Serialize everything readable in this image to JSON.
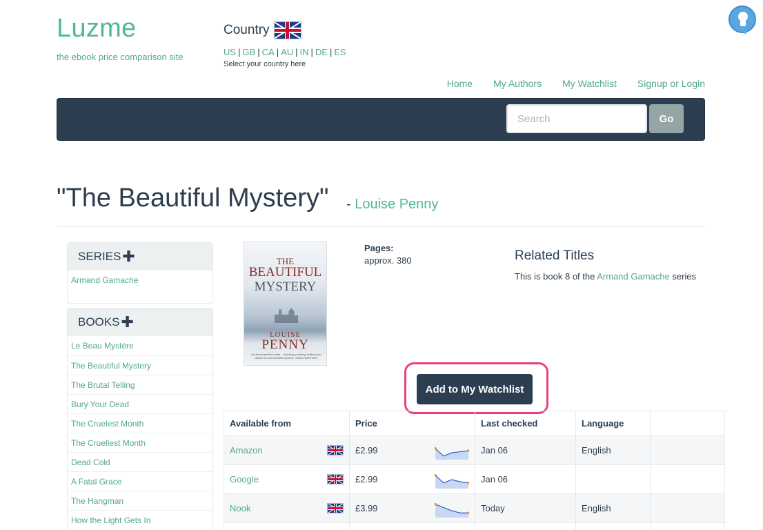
{
  "site": {
    "name": "Luzme",
    "tagline": "the ebook price comparison site"
  },
  "country": {
    "label": "Country",
    "current_flag": "uk-flag-icon",
    "options": [
      "US",
      "GB",
      "CA",
      "AU",
      "IN",
      "DE",
      "ES"
    ],
    "hint": "Select your country here"
  },
  "topnav": {
    "home": "Home",
    "authors": "My Authors",
    "watchlist": "My Watchlist",
    "login": "Signup or Login"
  },
  "search": {
    "placeholder": "Search",
    "button": "Go"
  },
  "book": {
    "title": "\"The Beautiful Mystery\"",
    "author_prefix": "- ",
    "author": "Louise Penny",
    "pages_label": "Pages:",
    "pages_value": "approx. 380",
    "cover": {
      "line1": "THE",
      "line2": "BEAUTIFUL",
      "line3": "MYSTERY",
      "author1": "LOUISE",
      "author2": "PENNY",
      "quote": "'An almost perfect crime – haunting, puzzling, brilliant and indeed a most beautiful mystery' LINDA FAIRSTEIN"
    }
  },
  "related": {
    "heading": "Related Titles",
    "text_before": "This is book 8 of the ",
    "series_link": "Armand Gamache",
    "text_after": " series"
  },
  "series_panel": {
    "heading": "SERIES",
    "items": [
      "Armand Gamache"
    ]
  },
  "books_panel": {
    "heading": "BOOKS",
    "items": [
      "Le Beau Mystère",
      "The Beautiful Mystery",
      "The Brutal Telling",
      "Bury Your Dead",
      "The Cruelest Month",
      "The Cruellest Month",
      "Dead Cold",
      "A Fatal Grace",
      "The Hangman",
      "How the Light Gets In"
    ]
  },
  "watchlist_button": "Add to My Watchlist",
  "prices": {
    "headers": [
      "Available from",
      "Price",
      "Last checked",
      "Language",
      ""
    ],
    "rows": [
      {
        "store": "Amazon",
        "price": "£2.99",
        "checked": "Jan 06",
        "language": "English",
        "trend": [
          5,
          12,
          9,
          8,
          7
        ]
      },
      {
        "store": "Google",
        "price": "£2.99",
        "checked": "Jan 06",
        "language": "",
        "trend": [
          3,
          10,
          7,
          9,
          10
        ]
      },
      {
        "store": "Nook",
        "price": "£3.99",
        "checked": "Today",
        "language": "English",
        "trend": [
          3,
          6,
          9,
          11,
          11
        ]
      }
    ]
  },
  "colors": {
    "brand": "#52b890",
    "link": "#52a88a",
    "navbar": "#2c3e50",
    "highlight": "#ec3e7b"
  }
}
